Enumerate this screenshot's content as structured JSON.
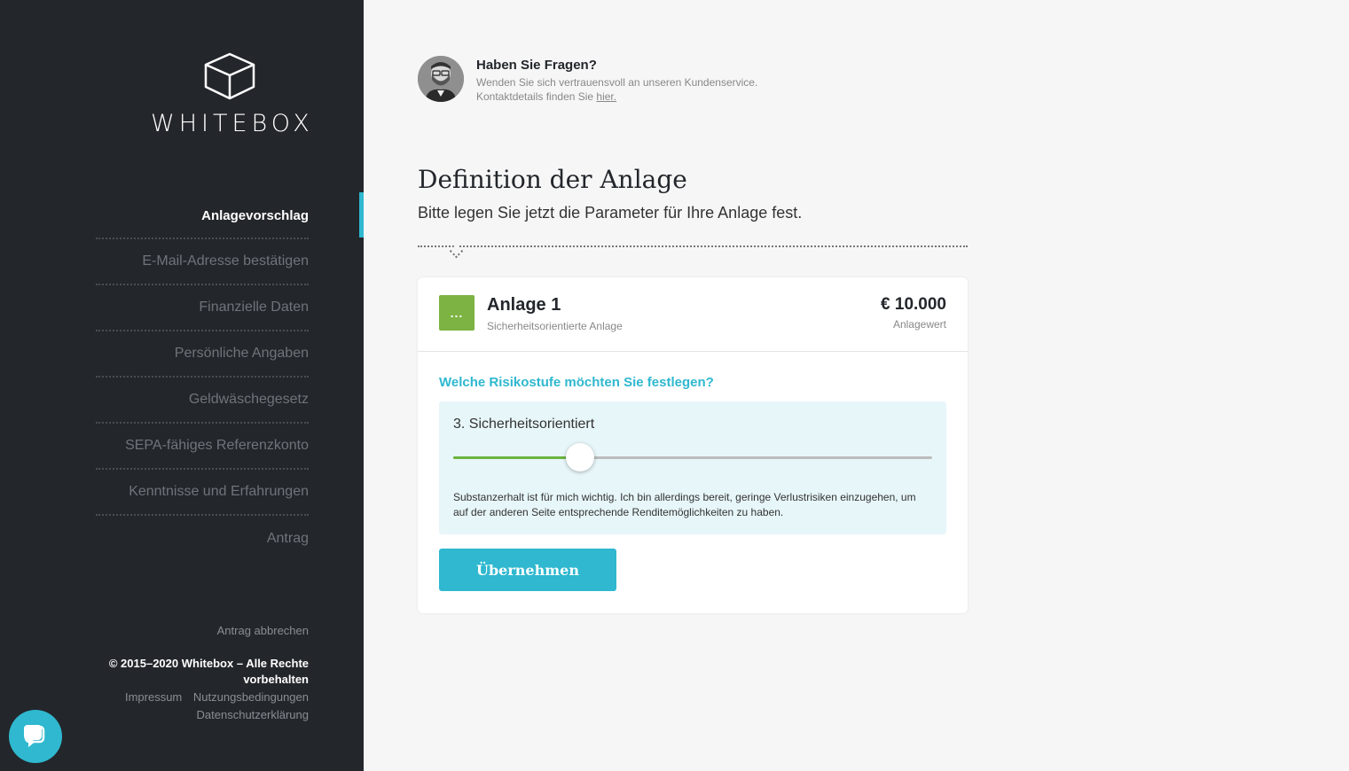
{
  "brand": {
    "name": "WHITEBOX",
    "logo_icon": "cube-icon",
    "accent": "#2fb8cf",
    "sidebar_bg": "#23262b"
  },
  "sidebar": {
    "steps": [
      {
        "label": "Anlagevorschlag",
        "active": true
      },
      {
        "label": "E-Mail-Adresse bestätigen"
      },
      {
        "label": "Finanzielle Daten"
      },
      {
        "label": "Persönliche Angaben"
      },
      {
        "label": "Geldwäschegesetz"
      },
      {
        "label": "SEPA-fähiges Referenzkonto"
      },
      {
        "label": "Kenntnisse und Erfahrungen"
      },
      {
        "label": "Antrag"
      }
    ],
    "cancel": "Antrag abbrechen",
    "copyright": "© 2015–2020 Whitebox – Alle Rechte vorbehalten",
    "links": {
      "impressum": "Impressum",
      "terms": "Nutzungsbedingungen",
      "privacy": "Datenschutzerklärung"
    },
    "chat_icon": "chat-bubble-icon"
  },
  "help": {
    "title": "Haben Sie Fragen?",
    "line1": "Wenden Sie sich vertrauensvoll an unseren Kundenservice.",
    "line2_prefix": "Kontaktdetails finden Sie ",
    "line2_link": "hier."
  },
  "main": {
    "title": "Definition der Anlage",
    "subtitle": "Bitte legen Sie jetzt die Parameter für Ihre Anlage fest."
  },
  "card": {
    "icon_text": "...",
    "icon_color": "#7cb342",
    "name": "Anlage 1",
    "type": "Sicherheitsorientierte Anlage",
    "amount": "€ 10.000",
    "amount_label": "Anlagewert",
    "question": "Welche Risikostufe möchten Sie festlegen?",
    "risk_level_label": "3. Sicherheitsorientiert",
    "slider_value": 0.265,
    "risk_description": "Substanzerhalt ist für mich wichtig. Ich bin allerdings bereit, geringe Verlustrisiken einzugehen, um auf der anderen Seite entsprechende Renditemöglichkeiten zu haben.",
    "submit_label": "Übernehmen"
  }
}
